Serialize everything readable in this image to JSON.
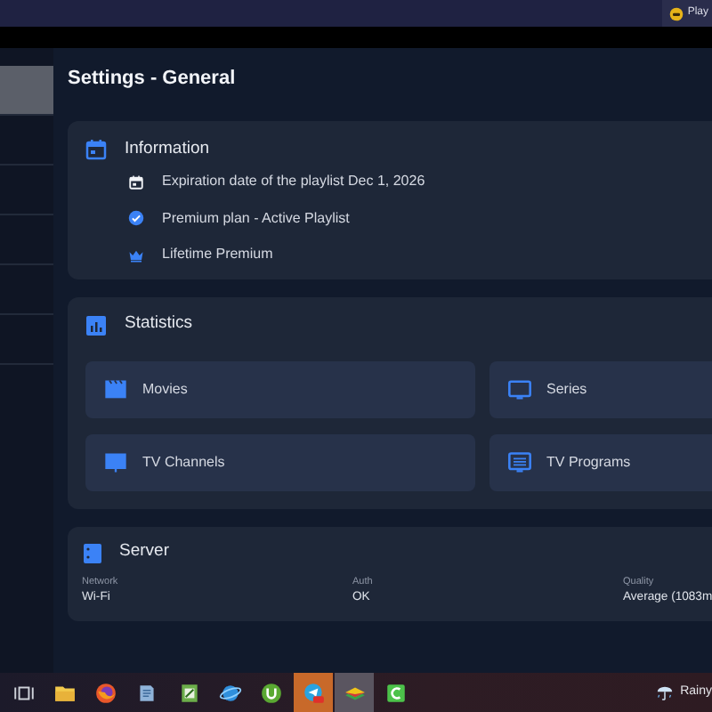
{
  "top_bar": {
    "app_label": "Play"
  },
  "sidebar": {
    "items": [
      {
        "selected": true
      },
      {
        "selected": false
      },
      {
        "selected": false
      },
      {
        "selected": false
      },
      {
        "selected": false
      },
      {
        "selected": false
      }
    ]
  },
  "page": {
    "title": "Settings - General"
  },
  "information": {
    "title": "Information",
    "rows": [
      {
        "kind": "calendar",
        "text": "Expiration date of the playlist Dec 1, 2026"
      },
      {
        "kind": "check",
        "text": "Premium plan - Active Playlist"
      },
      {
        "kind": "crown",
        "text": "Lifetime Premium"
      }
    ]
  },
  "statistics": {
    "title": "Statistics",
    "tiles": [
      {
        "kind": "movies",
        "label": "Movies"
      },
      {
        "kind": "series",
        "label": "Series"
      },
      {
        "kind": "channels",
        "label": "TV Channels"
      },
      {
        "kind": "programs",
        "label": "TV Programs"
      }
    ]
  },
  "server": {
    "title": "Server",
    "fields": [
      {
        "label": "Network",
        "value": "Wi-Fi"
      },
      {
        "label": "Auth",
        "value": "OK"
      },
      {
        "label": "Quality",
        "value": "Average (1083m"
      }
    ]
  },
  "taskbar": {
    "apps": [
      {
        "kind": "taskview",
        "selected": false
      },
      {
        "kind": "folder",
        "selected": false
      },
      {
        "kind": "firefox",
        "selected": false
      },
      {
        "kind": "notes",
        "selected": false
      },
      {
        "kind": "sheet",
        "selected": false
      },
      {
        "kind": "globe",
        "selected": false
      },
      {
        "kind": "torrent",
        "selected": false
      },
      {
        "kind": "telegram",
        "selected": false,
        "attention": true
      },
      {
        "kind": "layers",
        "selected": true
      },
      {
        "kind": "letter",
        "selected": false
      }
    ],
    "weather": {
      "text": "Rainy"
    }
  }
}
